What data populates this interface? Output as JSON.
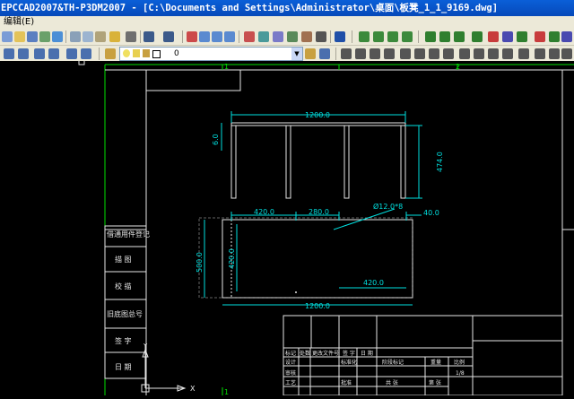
{
  "window": {
    "title": "EPCCAD2007&TH-P3DM2007 - [C:\\Documents and Settings\\Administrator\\桌面\\板凳_1_1_9169.dwg]"
  },
  "menu": {
    "edit": "编辑(E)"
  },
  "layer": {
    "current": "0"
  },
  "drawing": {
    "grid_labels": {
      "one_a": "1",
      "two": "2",
      "one_b": "1"
    },
    "dims": {
      "top_width": "1200.0",
      "leg_top": "6.0",
      "leg_height": "474.0",
      "seg_a": "420.0",
      "seg_b": "280.0",
      "hole": "Ø12.0*8",
      "offset": "40.0",
      "plan_depth": "500.0",
      "inner_depth": "420.0",
      "inner_width": "420.0",
      "plan_width": "1200.0"
    },
    "side_table": [
      "借通用件登记",
      "描 图",
      "校 描",
      "旧底图总号",
      "签 字",
      "日 期"
    ],
    "title_block": [
      "标记",
      "处数",
      "更改文件号",
      "签 字",
      "日 期",
      "设计",
      "标准化",
      "审核",
      "工艺",
      "批准",
      "阶段标记",
      "重量",
      "比例",
      "共 张",
      "第 张",
      "1/8"
    ]
  },
  "icons": [
    "layer-manager-icon",
    "zoom-icon",
    "pan-icon",
    "save-icon",
    "open-icon",
    "print-icon",
    "help-icon"
  ]
}
